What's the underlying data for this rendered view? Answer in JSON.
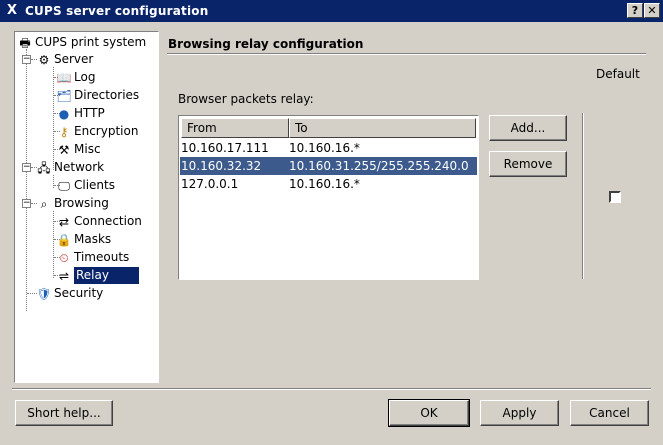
{
  "window": {
    "title": "CUPS server configuration",
    "help_button": "?",
    "close_button": "✕"
  },
  "tree": {
    "root": "CUPS print system",
    "server": "Server",
    "log": "Log",
    "directories": "Directories",
    "http": "HTTP",
    "encryption": "Encryption",
    "misc": "Misc",
    "network": "Network",
    "clients": "Clients",
    "browsing": "Browsing",
    "connection": "Connection",
    "masks": "Masks",
    "timeouts": "Timeouts",
    "relay": "Relay",
    "security": "Security"
  },
  "content": {
    "section_title": "Browsing relay configuration",
    "default_label": "Default",
    "relay_label": "Browser packets relay:",
    "columns": {
      "from": "From",
      "to": "To"
    },
    "rows": [
      {
        "from": "10.160.17.111",
        "to": "10.160.16.*"
      },
      {
        "from": "10.160.32.32",
        "to": "10.160.31.255/255.255.240.0"
      },
      {
        "from": "127.0.0.1",
        "to": "10.160.16.*"
      }
    ],
    "add_button": "Add...",
    "remove_button": "Remove",
    "default_checked": false
  },
  "footer": {
    "short_help": "Short help...",
    "ok": "OK",
    "apply": "Apply",
    "cancel": "Cancel"
  }
}
